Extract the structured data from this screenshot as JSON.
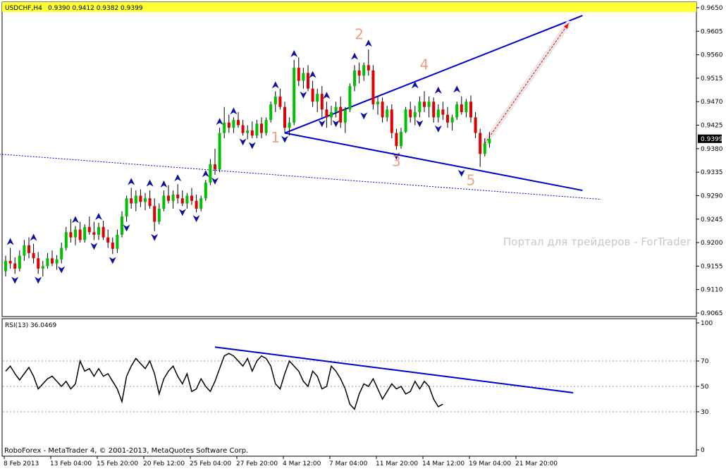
{
  "header": {
    "symbol": "USDCHF,H4",
    "ohlc": "0.9390 0.9412 0.9382 0.9399"
  },
  "watermark": "Портал для трейдеров - ForTrader",
  "footer": "RoboForex - MetaTrader 4, © 2001-2013, MetaQuotes Software Corp.",
  "colors": {
    "bull": "#00c000",
    "bear": "#e00000",
    "wick": "#000000",
    "fractal": "#1010a0",
    "trendline": "#0000cc",
    "wave_label": "#f0a080",
    "header_bar": "#ffff33",
    "arrow": "#ff0000",
    "rsi": "#000000"
  },
  "chart_data": [
    {
      "type": "candlestick",
      "timeframe": "H4",
      "ylim": [
        0.9065,
        0.965
      ],
      "last_price": 0.9399,
      "yticks": [
        "0.9650",
        "0.9605",
        "0.9560",
        "0.9515",
        "0.9470",
        "0.9425",
        "0.9380",
        "0.9335",
        "0.9290",
        "0.9245",
        "0.9200",
        "0.9155",
        "0.9110",
        "0.9065"
      ],
      "xticks": [
        "8 Feb 2013",
        "13 Feb 04:00",
        "15 Feb 20:00",
        "20 Feb 12:00",
        "25 Feb 04:00",
        "27 Feb 20:00",
        "4 Mar 12:00",
        "7 Mar 04:00",
        "11 Mar 20:00",
        "14 Mar 12:00",
        "19 Mar 04:00",
        "21 Mar 20:00"
      ],
      "candles": [
        [
          0.9145,
          0.9175,
          0.9135,
          0.9165
        ],
        [
          0.9165,
          0.919,
          0.915,
          0.916
        ],
        [
          0.916,
          0.9172,
          0.914,
          0.915
        ],
        [
          0.915,
          0.9185,
          0.9145,
          0.9175
        ],
        [
          0.9175,
          0.9205,
          0.9165,
          0.9195
        ],
        [
          0.9195,
          0.921,
          0.917,
          0.918
        ],
        [
          0.918,
          0.9198,
          0.916,
          0.917
        ],
        [
          0.917,
          0.9182,
          0.914,
          0.915
        ],
        [
          0.915,
          0.9165,
          0.9135,
          0.9155
        ],
        [
          0.9155,
          0.918,
          0.915,
          0.917
        ],
        [
          0.917,
          0.9185,
          0.9155,
          0.916
        ],
        [
          0.916,
          0.9176,
          0.9148,
          0.9168
        ],
        [
          0.9168,
          0.92,
          0.916,
          0.919
        ],
        [
          0.919,
          0.923,
          0.9185,
          0.922
        ],
        [
          0.922,
          0.9245,
          0.92,
          0.921
        ],
        [
          0.921,
          0.9232,
          0.9195,
          0.9225
        ],
        [
          0.9225,
          0.924,
          0.92,
          0.9205
        ],
        [
          0.9205,
          0.9235,
          0.92,
          0.923
        ],
        [
          0.923,
          0.925,
          0.9215,
          0.922
        ],
        [
          0.922,
          0.924,
          0.9205,
          0.9215
        ],
        [
          0.9215,
          0.9238,
          0.9205,
          0.923
        ],
        [
          0.923,
          0.9242,
          0.9205,
          0.921
        ],
        [
          0.921,
          0.9225,
          0.919,
          0.92
        ],
        [
          0.92,
          0.921,
          0.9178,
          0.9188
        ],
        [
          0.9188,
          0.9225,
          0.918,
          0.9215
        ],
        [
          0.9215,
          0.926,
          0.921,
          0.925
        ],
        [
          0.925,
          0.929,
          0.924,
          0.9285
        ],
        [
          0.9285,
          0.9305,
          0.9265,
          0.9275
        ],
        [
          0.9275,
          0.93,
          0.926,
          0.929
        ],
        [
          0.929,
          0.9302,
          0.9268,
          0.9278
        ],
        [
          0.9278,
          0.9295,
          0.9262,
          0.9285
        ],
        [
          0.9285,
          0.93,
          0.9265,
          0.927
        ],
        [
          0.927,
          0.9285,
          0.9222,
          0.924
        ],
        [
          0.924,
          0.9275,
          0.9235,
          0.9265
        ],
        [
          0.9265,
          0.93,
          0.926,
          0.929
        ],
        [
          0.929,
          0.931,
          0.9275,
          0.928
        ],
        [
          0.928,
          0.93,
          0.9265,
          0.9292
        ],
        [
          0.9292,
          0.9312,
          0.9275,
          0.9285
        ],
        [
          0.9285,
          0.93,
          0.927,
          0.9275
        ],
        [
          0.9275,
          0.9295,
          0.9265,
          0.929
        ],
        [
          0.929,
          0.9305,
          0.9272,
          0.928
        ],
        [
          0.928,
          0.9292,
          0.9258,
          0.9265
        ],
        [
          0.9265,
          0.929,
          0.926,
          0.9285
        ],
        [
          0.9285,
          0.932,
          0.928,
          0.9315
        ],
        [
          0.9315,
          0.936,
          0.931,
          0.935
        ],
        [
          0.935,
          0.938,
          0.933,
          0.934
        ],
        [
          0.934,
          0.942,
          0.9335,
          0.941
        ],
        [
          0.941,
          0.946,
          0.94,
          0.943
        ],
        [
          0.943,
          0.9445,
          0.941,
          0.942
        ],
        [
          0.942,
          0.944,
          0.941,
          0.9435
        ],
        [
          0.9435,
          0.945,
          0.942,
          0.9425
        ],
        [
          0.9425,
          0.9435,
          0.9405,
          0.941
        ],
        [
          0.941,
          0.9425,
          0.9398,
          0.9415
        ],
        [
          0.9415,
          0.9432,
          0.94,
          0.9405
        ],
        [
          0.9405,
          0.9435,
          0.94,
          0.9428
        ],
        [
          0.9428,
          0.944,
          0.94,
          0.941
        ],
        [
          0.941,
          0.944,
          0.9405,
          0.9435
        ],
        [
          0.9435,
          0.947,
          0.943,
          0.9465
        ],
        [
          0.9465,
          0.949,
          0.945,
          0.948
        ],
        [
          0.948,
          0.9495,
          0.9455,
          0.946
        ],
        [
          0.946,
          0.947,
          0.941,
          0.942
        ],
        [
          0.942,
          0.944,
          0.9405,
          0.943
        ],
        [
          0.943,
          0.955,
          0.9425,
          0.9535
        ],
        [
          0.9535,
          0.9555,
          0.95,
          0.951
        ],
        [
          0.951,
          0.9535,
          0.9495,
          0.9525
        ],
        [
          0.9525,
          0.954,
          0.949,
          0.9495
        ],
        [
          0.9495,
          0.951,
          0.946,
          0.947
        ],
        [
          0.947,
          0.9495,
          0.945,
          0.9485
        ],
        [
          0.9485,
          0.95,
          0.944,
          0.9455
        ],
        [
          0.9455,
          0.947,
          0.942,
          0.944
        ],
        [
          0.944,
          0.9462,
          0.9425,
          0.945
        ],
        [
          0.945,
          0.947,
          0.944,
          0.946
        ],
        [
          0.946,
          0.948,
          0.942,
          0.943
        ],
        [
          0.943,
          0.946,
          0.941,
          0.9455
        ],
        [
          0.9455,
          0.9505,
          0.945,
          0.95
        ],
        [
          0.95,
          0.954,
          0.949,
          0.953
        ],
        [
          0.953,
          0.9545,
          0.9505,
          0.952
        ],
        [
          0.952,
          0.9545,
          0.951,
          0.954
        ],
        [
          0.954,
          0.957,
          0.952,
          0.953
        ],
        [
          0.953,
          0.954,
          0.9455,
          0.9465
        ],
        [
          0.9465,
          0.948,
          0.9445,
          0.947
        ],
        [
          0.947,
          0.9478,
          0.943,
          0.944
        ],
        [
          0.944,
          0.9462,
          0.9432,
          0.9455
        ],
        [
          0.9455,
          0.9465,
          0.94,
          0.941
        ],
        [
          0.941,
          0.9418,
          0.9378,
          0.9385
        ],
        [
          0.9385,
          0.942,
          0.938,
          0.9412
        ],
        [
          0.9412,
          0.946,
          0.941,
          0.9455
        ],
        [
          0.9455,
          0.947,
          0.943,
          0.944
        ],
        [
          0.944,
          0.9462,
          0.9425,
          0.945
        ],
        [
          0.945,
          0.948,
          0.944,
          0.947
        ],
        [
          0.947,
          0.949,
          0.945,
          0.946
        ],
        [
          0.946,
          0.948,
          0.944,
          0.947
        ],
        [
          0.947,
          0.9478,
          0.943,
          0.944
        ],
        [
          0.944,
          0.9465,
          0.943,
          0.9455
        ],
        [
          0.9455,
          0.947,
          0.9435,
          0.9445
        ],
        [
          0.9445,
          0.946,
          0.942,
          0.943
        ],
        [
          0.943,
          0.9445,
          0.9415,
          0.944
        ],
        [
          0.944,
          0.947,
          0.9435,
          0.9465
        ],
        [
          0.9465,
          0.948,
          0.9445,
          0.945
        ],
        [
          0.945,
          0.9475,
          0.944,
          0.947
        ],
        [
          0.947,
          0.9482,
          0.943,
          0.944
        ],
        [
          0.944,
          0.945,
          0.94,
          0.941
        ],
        [
          0.941,
          0.9418,
          0.9345,
          0.937
        ],
        [
          0.937,
          0.94,
          0.9365,
          0.939
        ],
        [
          0.939,
          0.9412,
          0.9382,
          0.9399
        ]
      ],
      "fractals_up": [
        [
          1,
          0.919
        ],
        [
          6,
          0.9198
        ],
        [
          15,
          0.9232
        ],
        [
          20,
          0.9238
        ],
        [
          27,
          0.9305
        ],
        [
          31,
          0.9302
        ],
        [
          34,
          0.93
        ],
        [
          37,
          0.9312
        ],
        [
          43,
          0.932
        ],
        [
          46,
          0.942
        ],
        [
          49,
          0.944
        ],
        [
          58,
          0.949
        ],
        [
          62,
          0.955
        ],
        [
          66,
          0.951
        ],
        [
          69,
          0.947
        ],
        [
          75,
          0.9545
        ],
        [
          78,
          0.957
        ],
        [
          88,
          0.949
        ],
        [
          93,
          0.948
        ],
        [
          97,
          0.9482
        ]
      ],
      "fractals_down": [
        [
          2,
          0.914
        ],
        [
          7,
          0.914
        ],
        [
          12,
          0.916
        ],
        [
          19,
          0.9205
        ],
        [
          23,
          0.9178
        ],
        [
          26,
          0.924
        ],
        [
          32,
          0.9222
        ],
        [
          38,
          0.927
        ],
        [
          41,
          0.9258
        ],
        [
          45,
          0.933
        ],
        [
          51,
          0.9405
        ],
        [
          53,
          0.9398
        ],
        [
          60,
          0.941
        ],
        [
          64,
          0.9495
        ],
        [
          68,
          0.944
        ],
        [
          71,
          0.944
        ],
        [
          77,
          0.9455
        ],
        [
          84,
          0.9378
        ],
        [
          89,
          0.944
        ],
        [
          93,
          0.943
        ],
        [
          98,
          0.9345
        ]
      ],
      "trendlines": [
        {
          "from": [
            60,
            0.941
          ],
          "to": [
            124,
            0.9635
          ],
          "style": "solid"
        },
        {
          "from": [
            60,
            0.941
          ],
          "to": [
            124,
            0.93
          ],
          "style": "solid"
        },
        {
          "from": [
            -2,
            0.937
          ],
          "to": [
            128,
            0.9283
          ],
          "style": "dotted"
        }
      ],
      "target_arrow": {
        "from": [
          103,
          0.939
        ],
        "to": [
          121,
          0.962
        ]
      },
      "wave_labels": [
        {
          "text": "1",
          "x": 58,
          "y": 0.9392
        },
        {
          "text": "2",
          "x": 76,
          "y": 0.959
        },
        {
          "text": "3",
          "x": 84,
          "y": 0.9347
        },
        {
          "text": "4",
          "x": 90,
          "y": 0.9532
        },
        {
          "text": "5",
          "x": 100,
          "y": 0.931
        }
      ]
    },
    {
      "type": "line",
      "title": "RSI(13) 36.0469",
      "ylim": [
        0,
        100
      ],
      "levels": [
        30,
        50,
        70
      ],
      "yticks": [
        "100",
        "70",
        "50",
        "30",
        "0"
      ],
      "series": [
        {
          "values": [
            62,
            66,
            60,
            55,
            60,
            65,
            58,
            48,
            52,
            56,
            58,
            54,
            50,
            54,
            48,
            52,
            70,
            62,
            64,
            58,
            64,
            58,
            60,
            54,
            48,
            38,
            58,
            66,
            72,
            68,
            64,
            70,
            60,
            44,
            56,
            62,
            66,
            58,
            52,
            60,
            46,
            48,
            56,
            50,
            46,
            54,
            64,
            74,
            76,
            74,
            70,
            66,
            72,
            62,
            70,
            74,
            72,
            66,
            52,
            48,
            60,
            70,
            66,
            62,
            54,
            50,
            62,
            58,
            48,
            50,
            66,
            62,
            56,
            48,
            36,
            32,
            44,
            52,
            50,
            56,
            48,
            40,
            46,
            52,
            48,
            50,
            44,
            46,
            54,
            48,
            54,
            50,
            40,
            34,
            36
          ]
        }
      ],
      "trendline": {
        "from": [
          45,
          81
        ],
        "to": [
          122,
          45
        ]
      }
    }
  ]
}
